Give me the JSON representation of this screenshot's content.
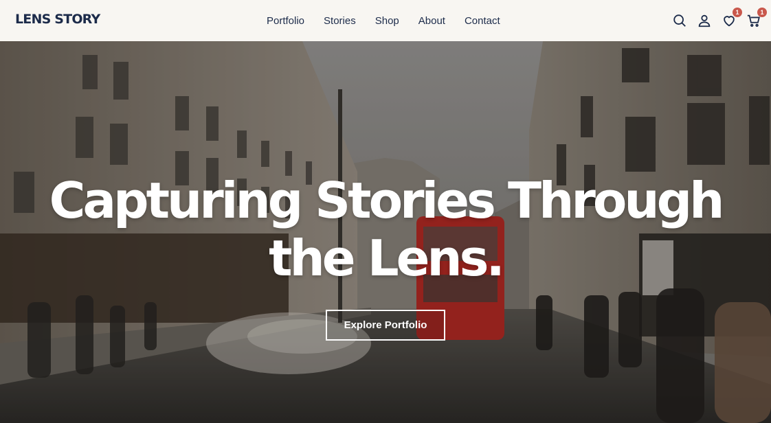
{
  "brand": {
    "logo": "LENS STORY"
  },
  "nav": [
    {
      "label": "Portfolio"
    },
    {
      "label": "Stories"
    },
    {
      "label": "Shop"
    },
    {
      "label": "About"
    },
    {
      "label": "Contact"
    }
  ],
  "header_icons": {
    "search": "search-icon",
    "account": "user-icon",
    "wishlist": {
      "icon": "heart-icon",
      "count": "1"
    },
    "cart": {
      "icon": "cart-icon",
      "count": "1"
    }
  },
  "hero": {
    "headline_line1": "Capturing Stories Through",
    "headline_line2": "the Lens.",
    "cta_label": "Explore Portfolio"
  },
  "colors": {
    "header_bg": "#f8f6f2",
    "brand_navy": "#1c2b4a",
    "badge": "#c9584c",
    "bus_red": "#b42a24"
  }
}
